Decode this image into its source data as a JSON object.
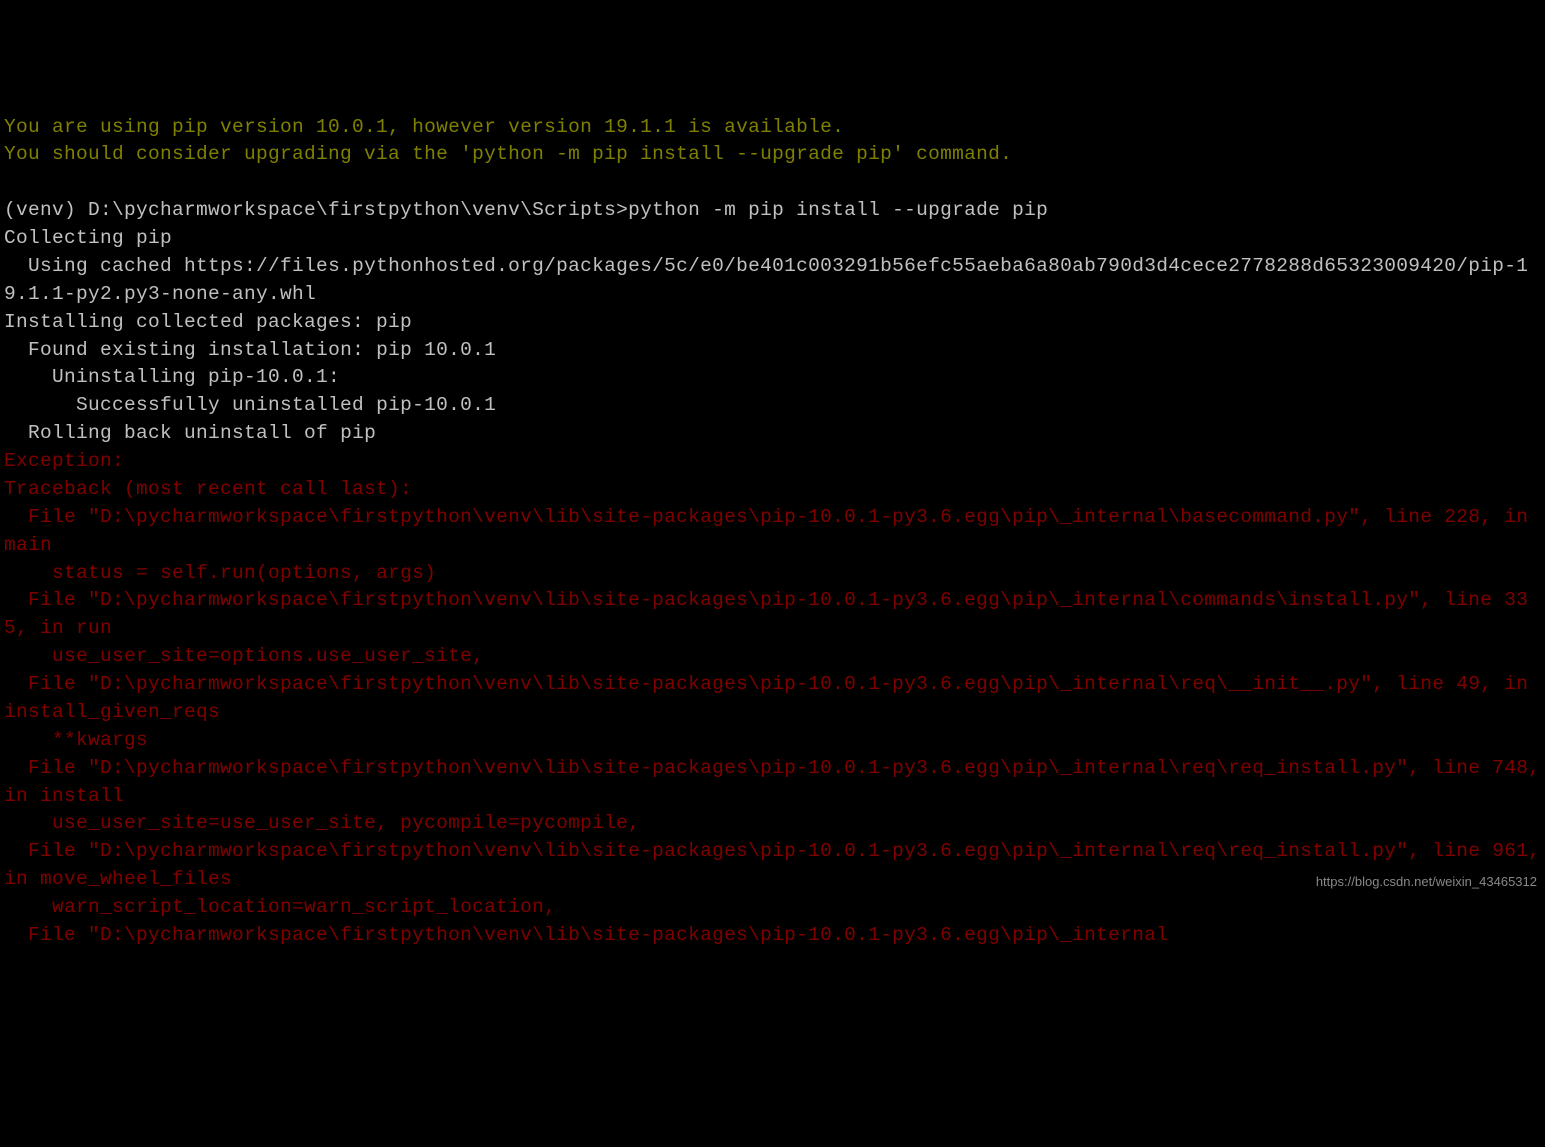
{
  "terminal": {
    "lines": [
      {
        "cls": "line-yellow",
        "text": "You are using pip version 10.0.1, however version 19.1.1 is available."
      },
      {
        "cls": "line-yellow",
        "text": "You should consider upgrading via the 'python -m pip install --upgrade pip' command."
      },
      {
        "cls": "line-white",
        "text": ""
      },
      {
        "cls": "line-white",
        "text": "(venv) D:\\pycharmworkspace\\firstpython\\venv\\Scripts>python -m pip install --upgrade pip"
      },
      {
        "cls": "line-white",
        "text": "Collecting pip"
      },
      {
        "cls": "line-white",
        "text": "  Using cached https://files.pythonhosted.org/packages/5c/e0/be401c003291b56efc55aeba6a80ab790d3d4cece2778288d65323009420/pip-19.1.1-py2.py3-none-any.whl"
      },
      {
        "cls": "line-white",
        "text": "Installing collected packages: pip"
      },
      {
        "cls": "line-white",
        "text": "  Found existing installation: pip 10.0.1"
      },
      {
        "cls": "line-white",
        "text": "    Uninstalling pip-10.0.1:"
      },
      {
        "cls": "line-white",
        "text": "      Successfully uninstalled pip-10.0.1"
      },
      {
        "cls": "line-white",
        "text": "  Rolling back uninstall of pip"
      },
      {
        "cls": "line-red",
        "text": "Exception:"
      },
      {
        "cls": "line-red",
        "text": "Traceback (most recent call last):"
      },
      {
        "cls": "line-red",
        "text": "  File \"D:\\pycharmworkspace\\firstpython\\venv\\lib\\site-packages\\pip-10.0.1-py3.6.egg\\pip\\_internal\\basecommand.py\", line 228, in main"
      },
      {
        "cls": "line-red",
        "text": "    status = self.run(options, args)"
      },
      {
        "cls": "line-red",
        "text": "  File \"D:\\pycharmworkspace\\firstpython\\venv\\lib\\site-packages\\pip-10.0.1-py3.6.egg\\pip\\_internal\\commands\\install.py\", line 335, in run"
      },
      {
        "cls": "line-red",
        "text": "    use_user_site=options.use_user_site,"
      },
      {
        "cls": "line-red",
        "text": "  File \"D:\\pycharmworkspace\\firstpython\\venv\\lib\\site-packages\\pip-10.0.1-py3.6.egg\\pip\\_internal\\req\\__init__.py\", line 49, in install_given_reqs"
      },
      {
        "cls": "line-red",
        "text": "    **kwargs"
      },
      {
        "cls": "line-red",
        "text": "  File \"D:\\pycharmworkspace\\firstpython\\venv\\lib\\site-packages\\pip-10.0.1-py3.6.egg\\pip\\_internal\\req\\req_install.py\", line 748, in install"
      },
      {
        "cls": "line-red",
        "text": "    use_user_site=use_user_site, pycompile=pycompile,"
      },
      {
        "cls": "line-red",
        "text": "  File \"D:\\pycharmworkspace\\firstpython\\venv\\lib\\site-packages\\pip-10.0.1-py3.6.egg\\pip\\_internal\\req\\req_install.py\", line 961, in move_wheel_files"
      },
      {
        "cls": "line-red",
        "text": "    warn_script_location=warn_script_location,"
      },
      {
        "cls": "line-red",
        "text": "  File \"D:\\pycharmworkspace\\firstpython\\venv\\lib\\site-packages\\pip-10.0.1-py3.6.egg\\pip\\_internal"
      }
    ],
    "watermark": "https://blog.csdn.net/weixin_43465312"
  }
}
